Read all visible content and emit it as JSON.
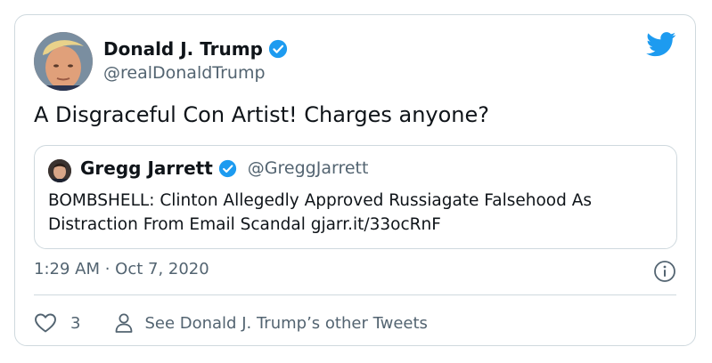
{
  "tweet": {
    "author": {
      "display_name": "Donald J. Trump",
      "handle": "@realDonaldTrump",
      "verified": true
    },
    "text": "A Disgraceful Con Artist! Charges anyone?",
    "quoted": {
      "display_name": "Gregg Jarrett",
      "handle": "@GreggJarrett",
      "verified": true,
      "text": "BOMBSHELL: Clinton Allegedly Approved Russiagate Falsehood As Distraction From Email Scandal gjarr.it/33ocRnF"
    },
    "timestamp": "1:29 AM · Oct 7, 2020",
    "like_count": "3",
    "other_tweets_link": "See Donald J. Trump’s other Tweets"
  },
  "icons": {
    "brand": "twitter-bird-icon",
    "verified": "verified-badge-icon",
    "info": "info-icon",
    "like": "heart-icon",
    "profile": "person-icon"
  },
  "colors": {
    "brand_blue": "#1d9bf0",
    "text_primary": "#0f1419",
    "text_secondary": "#536471",
    "border": "#cfd9de"
  }
}
